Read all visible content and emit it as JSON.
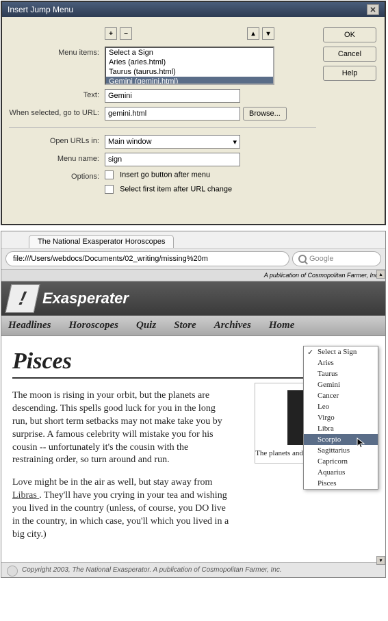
{
  "dialog": {
    "title": "Insert Jump Menu",
    "ok": "OK",
    "cancel": "Cancel",
    "help": "Help",
    "menu_items_label": "Menu items:",
    "list": [
      "Select a Sign",
      "Aries (aries.html)",
      "Taurus (taurus.html)",
      "Gemini (gemini.html)"
    ],
    "selected_index": 3,
    "text_label": "Text:",
    "text_value": "Gemini",
    "url_label": "When selected, go to URL:",
    "url_value": "gemini.html",
    "browse": "Browse...",
    "open_label": "Open URLs in:",
    "open_value": "Main window",
    "name_label": "Menu name:",
    "name_value": "sign",
    "options_label": "Options:",
    "opt1": "Insert go button after menu",
    "opt2": "Select first item after URL change"
  },
  "browser": {
    "tab_title": "The National Exasperator Horoscopes",
    "url": "file:///Users/webdocs/Documents/02_writing/missing%20m",
    "search_placeholder": "Google",
    "pub_note": "A publication of Cosmopolitan Farmer, Inc.",
    "brand": "Exasperater",
    "nav": [
      "Headlines",
      "Horoscopes",
      "Quiz",
      "Store",
      "Archives",
      "Home"
    ],
    "heading": "Pisces",
    "para1": "The moon is rising in your orbit, but the planets are descending. This spells good luck for you in the long run, but short term setbacks may not make take you by surprise. A famous celebrity will mistake you for his cousin -- unfortunately it's the cousin with the restraining order, so turn around and run.",
    "para2a": "Love might be in the air as well, but stay away from ",
    "para2_link": "Libras ",
    "para2b": ". They'll have you crying in your tea and wishing you lived in the country (unless, of course, you DO live in the country, in which case, you'll which you lived in a big city.)",
    "aside_txt": "The planets and the stars of your future",
    "copyright": "Copyright 2003, The National Exasperator. A publication of Cosmopolitan Farmer, Inc.",
    "signs": [
      "Select a Sign",
      "Aries",
      "Taurus",
      "Gemini",
      "Cancer",
      "Leo",
      "Virgo",
      "Libra",
      "Scorpio",
      "Sagittarius",
      "Capricorn",
      "Aquarius",
      "Pisces"
    ],
    "checked_index": 0,
    "hover_index": 8
  }
}
